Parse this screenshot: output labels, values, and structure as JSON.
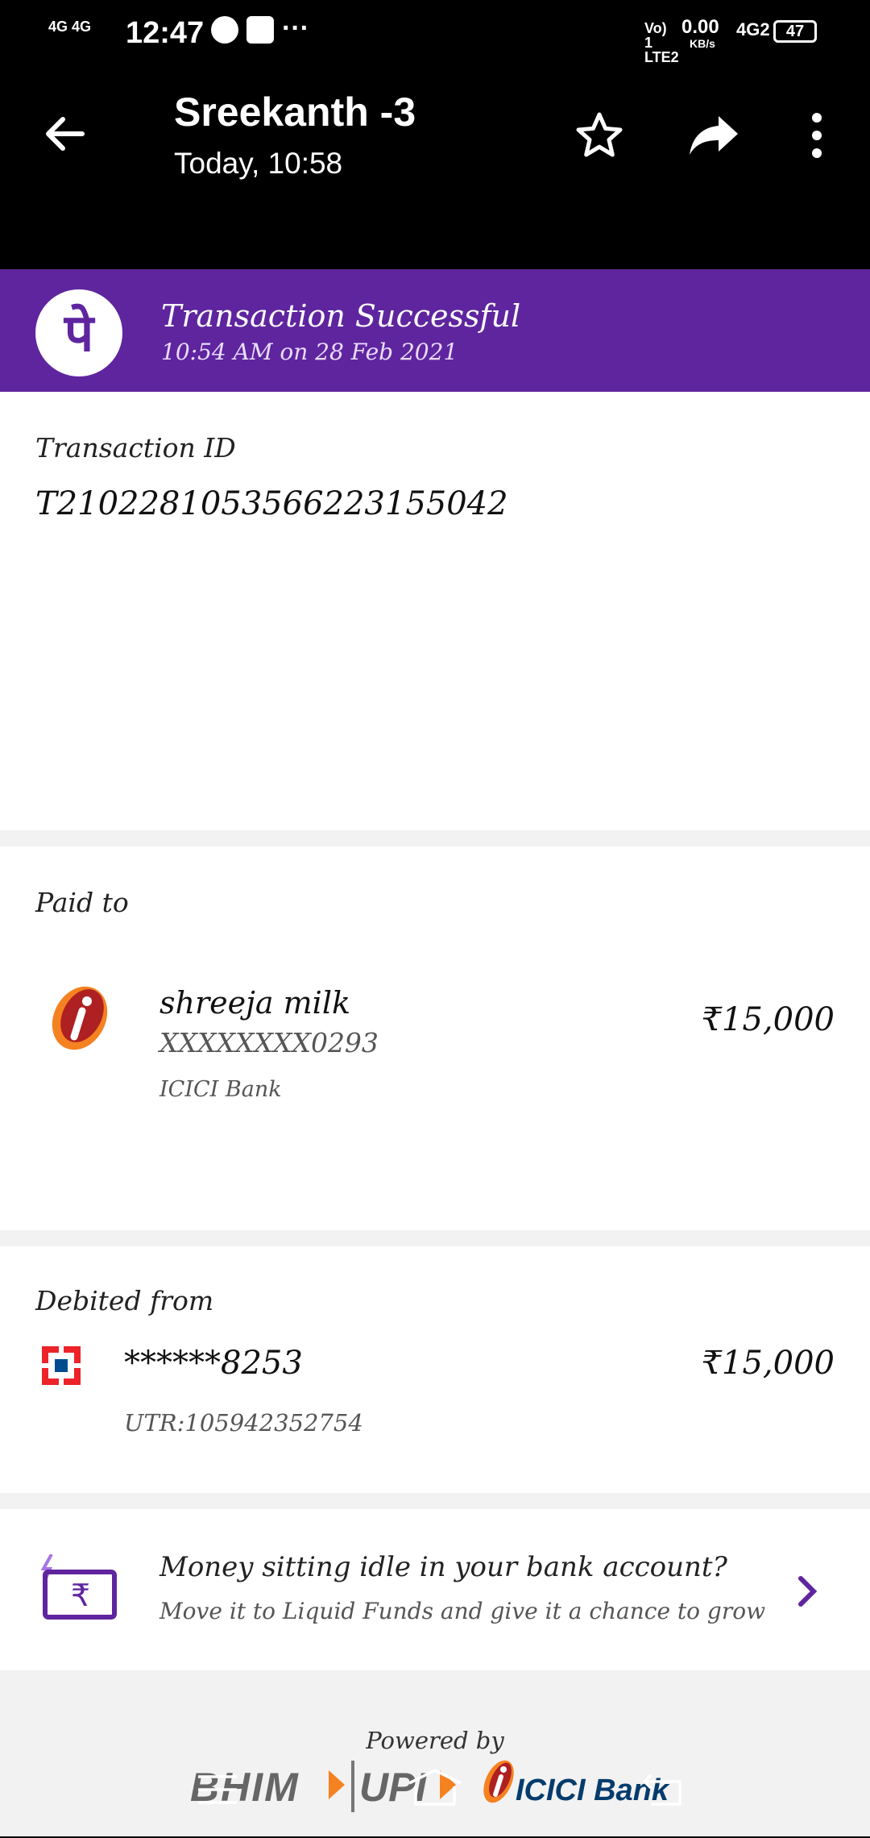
{
  "status_bar": {
    "time": "12:47",
    "signal_left": "4G 4G",
    "speed": "0.00",
    "speed_unit": "KB/s",
    "volte": "Vo) 1 LTE2",
    "network_right": "4G2",
    "battery": "47"
  },
  "header": {
    "title": "Sreekanth -3",
    "subtitle": "Today, 10:58"
  },
  "banner": {
    "logo_glyph": "पे",
    "title": "Transaction Successful",
    "datetime": "10:54 AM on 28 Feb 2021"
  },
  "transaction": {
    "id_label": "Transaction ID",
    "id_value": "T2102281053566223155042"
  },
  "paid_to": {
    "label": "Paid to",
    "name": "shreeja milk",
    "account": "XXXXXXXX0293",
    "bank": "ICICI Bank",
    "amount": "₹15,000"
  },
  "debited_from": {
    "label": "Debited from",
    "account": "******8253",
    "utr": "UTR:105942352754",
    "amount": "₹15,000"
  },
  "promo": {
    "title": "Money sitting idle in your bank account?",
    "subtitle": "Move it to Liquid Funds and give it a chance to grow",
    "rupee_glyph": "₹"
  },
  "footer": {
    "powered_by": "Powered by",
    "bhim": "BHIM",
    "upi": "UPI",
    "icici": "ICICI Bank"
  },
  "colors": {
    "accent": "#5f259f",
    "icici_orange": "#f58220",
    "icici_red": "#ae2021"
  }
}
